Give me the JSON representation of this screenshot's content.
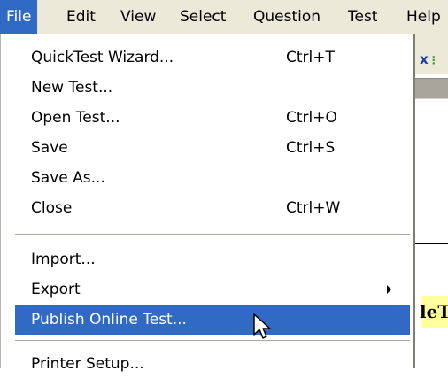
{
  "menubar": {
    "items": [
      "File",
      "Edit",
      "View",
      "Select",
      "Question",
      "Test",
      "Help"
    ],
    "active": "File"
  },
  "file_menu": {
    "items": [
      {
        "label": "QuickTest Wizard...",
        "shortcut": "Ctrl+T"
      },
      {
        "label": "New Test...",
        "shortcut": ""
      },
      {
        "label": "Open Test...",
        "shortcut": "Ctrl+O"
      },
      {
        "label": "Save",
        "shortcut": "Ctrl+S"
      },
      {
        "label": "Save As...",
        "shortcut": ""
      },
      {
        "label": "Close",
        "shortcut": "Ctrl+W"
      },
      {
        "label": "Import...",
        "shortcut": ""
      },
      {
        "label": "Export",
        "shortcut": "",
        "submenu": true
      },
      {
        "label": "Publish Online Test...",
        "shortcut": "",
        "highlighted": true
      },
      {
        "label": "Printer Setup...",
        "shortcut": ""
      }
    ]
  },
  "background": {
    "toolbar_icon_glyph": "x",
    "highlight_text": "leT"
  },
  "colors": {
    "menubar_bg": "#ece9d8",
    "selection": "#316ac5",
    "menu_bg": "#ffffff"
  }
}
